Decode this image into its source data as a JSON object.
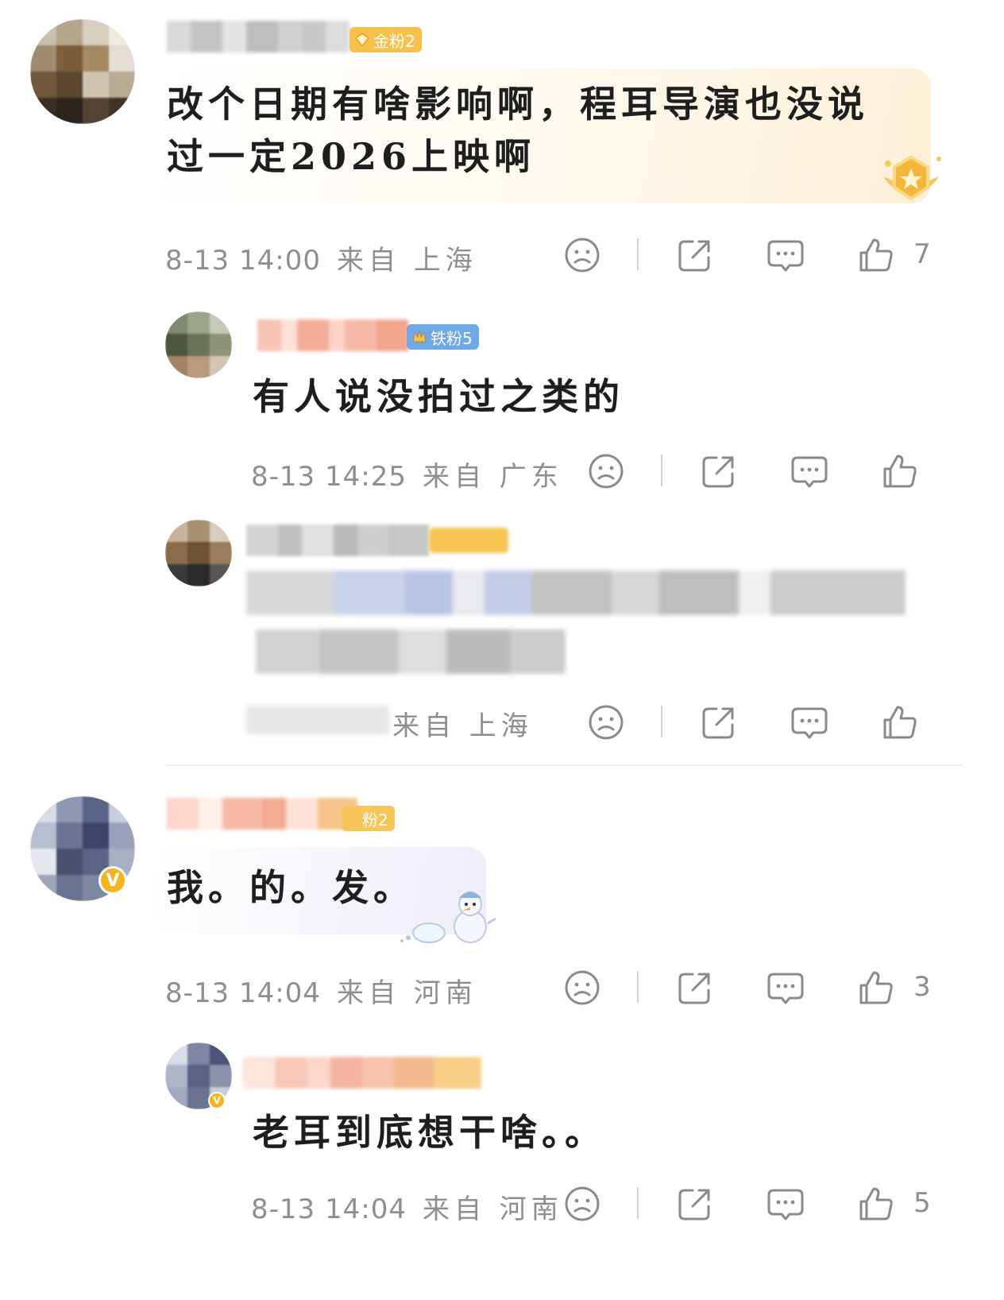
{
  "comments": [
    {
      "fan_badge": "金粉2",
      "text": "改个日期有啥影响啊，程耳导演也没说过一定2026上映啊",
      "time": "8-13 14:00",
      "location": "来自 上海",
      "likes": "7"
    },
    {
      "fan_badge": "铁粉5",
      "text": "有人说没拍过之类的",
      "time": "8-13 14:25",
      "location": "来自 广东",
      "likes": ""
    },
    {
      "fan_badge": "",
      "text": "",
      "time": "",
      "location": "来自 上海",
      "likes": ""
    },
    {
      "fan_badge": "粉2",
      "text": "我。的。发。",
      "time": "8-13 14:04",
      "location": "来自 河南",
      "likes": "3"
    },
    {
      "fan_badge": "",
      "text": "老耳到底想干啥。。",
      "time": "8-13 14:04",
      "location": "来自 河南",
      "likes": "5"
    }
  ],
  "colors": {
    "gold_badge": "#f6c04a",
    "iron_badge": "#6fa8e8",
    "meta_gray": "#8e8e8e",
    "verified": "#f6b51c"
  },
  "icons": [
    "sad-face-icon",
    "share-icon",
    "comment-icon",
    "thumbs-up-icon",
    "verified-v-icon"
  ]
}
